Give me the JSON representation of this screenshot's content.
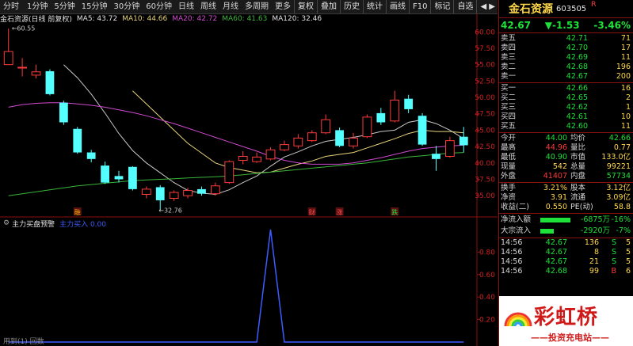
{
  "toolbar": {
    "periods": [
      "分时",
      "1分钟",
      "5分钟",
      "15分钟",
      "30分钟",
      "60分钟",
      "日线",
      "周线",
      "月线",
      "多周期",
      "更多"
    ],
    "buttons": [
      "复权",
      "叠加",
      "历史",
      "统计",
      "画线",
      "F10",
      "标记",
      "自选"
    ],
    "nav_arrows": "◀ ▶"
  },
  "ma_bar": {
    "title": "金石资源(日线 前复权)",
    "ma5": "MA5: 43.72",
    "ma10": "MA10: 44.66",
    "ma20": "MA20: 42.72",
    "ma60": "MA60: 41.63",
    "ma120": "MA120: 32.46"
  },
  "indicator_bar": {
    "title": "主力买盘预警",
    "value": "主力买入 0.00"
  },
  "chart_data": [
    {
      "type": "candlestick",
      "ylim": [
        32,
        61
      ],
      "y_ticks": [
        "60.00",
        "57.50",
        "55.00",
        "52.50",
        "50.00",
        "47.50",
        "45.00",
        "42.50",
        "40.00",
        "37.50",
        "35.00"
      ],
      "annotations": {
        "high_label": "60.55",
        "low_label": "32.76"
      },
      "markers": [
        "融",
        "财",
        "涨",
        "跌"
      ],
      "candles": [
        {
          "o": 55.0,
          "c": 57.0,
          "h": 60.5,
          "l": 55.0
        },
        {
          "o": 54.6,
          "c": 54.6,
          "h": 56.0,
          "l": 53.2
        },
        {
          "o": 53.4,
          "c": 53.9,
          "h": 55.0,
          "l": 52.9
        },
        {
          "o": 54.0,
          "c": 50.5,
          "h": 54.3,
          "l": 50.3
        },
        {
          "o": 49.2,
          "c": 46.2,
          "h": 49.5,
          "l": 45.8
        },
        {
          "o": 45.2,
          "c": 41.6,
          "h": 45.5,
          "l": 41.4
        },
        {
          "o": 41.6,
          "c": 40.6,
          "h": 42.0,
          "l": 40.1
        },
        {
          "o": 39.6,
          "c": 37.0,
          "h": 40.2,
          "l": 36.8
        },
        {
          "o": 38.0,
          "c": 37.5,
          "h": 38.8,
          "l": 37.0
        },
        {
          "o": 39.4,
          "c": 36.0,
          "h": 39.5,
          "l": 35.8
        },
        {
          "o": 35.2,
          "c": 36.0,
          "h": 36.4,
          "l": 34.6
        },
        {
          "o": 36.3,
          "c": 34.3,
          "h": 36.6,
          "l": 32.8
        },
        {
          "o": 34.6,
          "c": 35.5,
          "h": 35.8,
          "l": 34.2
        },
        {
          "o": 35.0,
          "c": 35.8,
          "h": 36.2,
          "l": 34.6
        },
        {
          "o": 36.0,
          "c": 35.3,
          "h": 36.4,
          "l": 35.0
        },
        {
          "o": 35.3,
          "c": 36.5,
          "h": 37.0,
          "l": 35.0
        },
        {
          "o": 37.0,
          "c": 40.2,
          "h": 40.4,
          "l": 36.8
        },
        {
          "o": 40.4,
          "c": 41.0,
          "h": 41.8,
          "l": 39.8
        },
        {
          "o": 40.2,
          "c": 40.9,
          "h": 41.6,
          "l": 40.0
        },
        {
          "o": 40.6,
          "c": 42.0,
          "h": 42.4,
          "l": 40.4
        },
        {
          "o": 42.0,
          "c": 42.8,
          "h": 43.4,
          "l": 41.8
        },
        {
          "o": 42.6,
          "c": 43.8,
          "h": 44.4,
          "l": 42.2
        },
        {
          "o": 43.4,
          "c": 44.6,
          "h": 45.0,
          "l": 43.2
        },
        {
          "o": 44.6,
          "c": 46.6,
          "h": 47.4,
          "l": 44.4
        },
        {
          "o": 45.0,
          "c": 42.6,
          "h": 45.4,
          "l": 42.4
        },
        {
          "o": 42.6,
          "c": 43.8,
          "h": 44.6,
          "l": 42.2
        },
        {
          "o": 44.0,
          "c": 47.0,
          "h": 47.4,
          "l": 43.8
        },
        {
          "o": 47.6,
          "c": 46.2,
          "h": 48.4,
          "l": 45.8
        },
        {
          "o": 46.4,
          "c": 49.6,
          "h": 51.0,
          "l": 46.2
        },
        {
          "o": 49.8,
          "c": 48.2,
          "h": 50.4,
          "l": 47.6
        },
        {
          "o": 47.2,
          "c": 42.8,
          "h": 47.6,
          "l": 42.6
        },
        {
          "o": 41.4,
          "c": 40.6,
          "h": 42.6,
          "l": 38.8
        },
        {
          "o": 41.0,
          "c": 43.4,
          "h": 44.0,
          "l": 40.8
        },
        {
          "o": 44.0,
          "c": 42.7,
          "h": 45.5,
          "l": 41.6
        }
      ],
      "ma_series": [
        {
          "name": "MA5",
          "color": "#c8c8c8",
          "values": [
            null,
            null,
            null,
            null,
            55.0,
            53.0,
            50.5,
            47.6,
            44.5,
            41.9,
            40.0,
            38.5,
            37.0,
            35.8,
            35.4,
            35.2,
            35.9,
            37.0,
            38.0,
            39.5,
            40.9,
            41.7,
            42.6,
            43.3,
            43.6,
            43.9,
            44.3,
            44.8,
            45.0,
            46.2,
            46.6,
            46.0,
            45.0,
            43.7
          ]
        },
        {
          "name": "MA10",
          "color": "#e8d47a",
          "values": [
            null,
            null,
            null,
            null,
            null,
            null,
            null,
            null,
            null,
            51.0,
            49.0,
            47.0,
            45.0,
            43.0,
            41.5,
            40.0,
            39.3,
            38.9,
            38.5,
            38.6,
            39.2,
            39.8,
            40.3,
            41.0,
            41.3,
            41.6,
            42.3,
            43.0,
            43.7,
            44.5,
            45.0,
            44.8,
            44.8,
            44.6
          ]
        },
        {
          "name": "MA20",
          "color": "#d04ad0",
          "values": [
            48.5,
            48.9,
            49.1,
            49.2,
            49.2,
            49.0,
            48.8,
            48.5,
            48.1,
            47.7,
            47.2,
            46.6,
            46.0,
            45.3,
            44.6,
            43.9,
            43.2,
            42.5,
            41.8,
            41.0,
            40.4,
            40.0,
            39.8,
            39.8,
            39.8,
            40.0,
            40.4,
            40.8,
            41.3,
            41.8,
            42.2,
            42.4,
            42.6,
            42.7
          ]
        },
        {
          "name": "MA60",
          "color": "#3ab53a",
          "values": [
            35.0,
            35.3,
            35.6,
            35.9,
            36.2,
            36.5,
            36.7,
            36.9,
            37.1,
            37.3,
            37.4,
            37.5,
            37.6,
            37.7,
            37.8,
            37.9,
            38.0,
            38.2,
            38.4,
            38.6,
            38.8,
            39.0,
            39.2,
            39.4,
            39.6,
            39.8,
            40.0,
            40.3,
            40.6,
            40.9,
            41.1,
            41.3,
            41.5,
            41.6
          ]
        }
      ]
    },
    {
      "type": "line",
      "ylim": [
        0,
        1
      ],
      "y_ticks": [
        "0.80",
        "0.60",
        "0.40",
        "0.20"
      ],
      "series": [
        {
          "name": "主力买入",
          "color": "#3c5cff",
          "values": [
            0,
            0,
            0,
            0,
            0,
            0,
            0,
            0,
            0,
            0,
            0,
            0,
            0,
            0,
            0,
            0,
            0,
            0,
            0,
            1,
            0,
            0,
            0,
            0,
            0,
            0,
            0,
            0,
            0,
            0,
            0,
            0,
            0,
            0
          ]
        }
      ]
    }
  ],
  "quote": {
    "name": "金石资源",
    "code": "603505",
    "r_mark": "R",
    "price": "42.67",
    "change": "▼-1.53",
    "pct": "-3.46%",
    "asks": [
      {
        "label": "卖五",
        "price": "42.71",
        "vol": "71"
      },
      {
        "label": "卖四",
        "price": "42.70",
        "vol": "17"
      },
      {
        "label": "卖三",
        "price": "42.69",
        "vol": "11"
      },
      {
        "label": "卖二",
        "price": "42.68",
        "vol": "196"
      },
      {
        "label": "卖一",
        "price": "42.67",
        "vol": "200"
      }
    ],
    "bids": [
      {
        "label": "买一",
        "price": "42.66",
        "vol": "16"
      },
      {
        "label": "买二",
        "price": "42.65",
        "vol": "2"
      },
      {
        "label": "买三",
        "price": "42.62",
        "vol": "1"
      },
      {
        "label": "买四",
        "price": "42.61",
        "vol": "10"
      },
      {
        "label": "买五",
        "price": "42.60",
        "vol": "11"
      }
    ],
    "stats": [
      {
        "l1": "今开",
        "v1": "44.00",
        "c1": "#1ee23a",
        "l2": "均价",
        "v2": "42.66",
        "c2": "#1ee23a"
      },
      {
        "l1": "最高",
        "v1": "44.96",
        "c1": "#ff3b3b",
        "l2": "量比",
        "v2": "0.77",
        "c2": "#ffd84a"
      },
      {
        "l1": "最低",
        "v1": "40.90",
        "c1": "#1ee23a",
        "l2": "市值",
        "v2": "133.0亿",
        "c2": "#ffd84a"
      },
      {
        "l1": "现量",
        "v1": "542",
        "c1": "#ffd84a",
        "l2": "总量",
        "v2": "99221",
        "c2": "#ffd84a"
      },
      {
        "l1": "外盘",
        "v1": "41407",
        "c1": "#ff3b3b",
        "l2": "内盘",
        "v2": "57734",
        "c2": "#1ee23a"
      }
    ],
    "stats2": [
      {
        "l1": "换手",
        "v1": "3.21%",
        "l2": "股本",
        "v2": "3.12亿"
      },
      {
        "l1": "净资",
        "v1": "3.91",
        "l2": "流通",
        "v2": "3.09亿"
      },
      {
        "l1": "收益(二)",
        "v1": "0.550",
        "l2": "PE(动)",
        "v2": "58.8"
      }
    ],
    "flows": [
      {
        "label": "净流入额",
        "value": "-6875万",
        "pct": "-16%",
        "fill": 0.16
      },
      {
        "label": "大宗流入",
        "value": "-2920万",
        "pct": "-7%",
        "fill": 0.07
      }
    ],
    "ticks": [
      {
        "t": "14:56",
        "p": "42.67",
        "v": "136",
        "d": "S",
        "n": "5"
      },
      {
        "t": "14:56",
        "p": "42.67",
        "v": "8",
        "d": "S",
        "n": "5"
      },
      {
        "t": "14:56",
        "p": "42.67",
        "v": "21",
        "d": "S",
        "n": "5"
      },
      {
        "t": "14:56",
        "p": "42.68",
        "v": "99",
        "d": "B",
        "n": "6"
      }
    ]
  },
  "watermark": {
    "text": "彩虹桥",
    "sub": "——投资充电站——"
  },
  "bottom_tab": "用到(1) 回数"
}
